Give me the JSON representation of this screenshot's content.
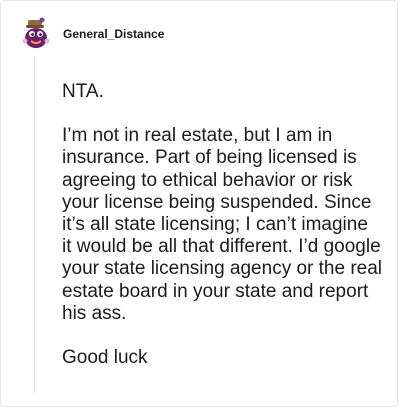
{
  "comment": {
    "author": "General_Distance",
    "paragraphs": [
      "NTA.",
      "I’m not in real estate, but I am in insurance. Part of being licensed is agreeing to ethical behavior or risk your license being suspended. Since it’s all state licensing; I can’t imagine it would be all that different. I’d google your state licensing agency or the real estate board in your state and report his ass.",
      "Good luck"
    ]
  },
  "colors": {
    "avatar_body": "#6b1f6e",
    "avatar_hat": "#8c6a3a",
    "text": "#1c1c1c"
  }
}
